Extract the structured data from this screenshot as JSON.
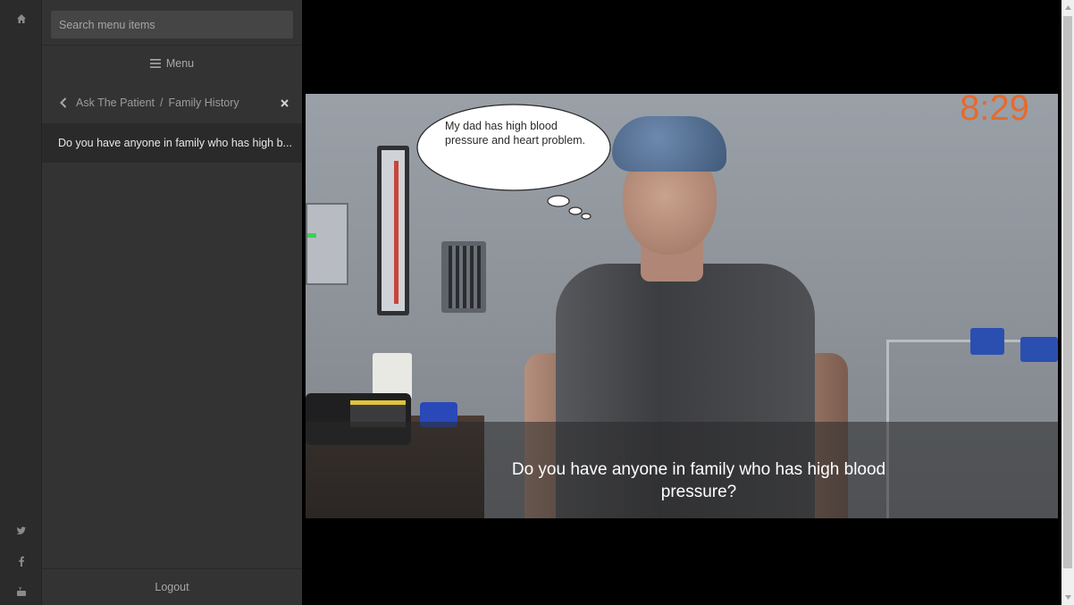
{
  "rail": {
    "home_icon": "home-icon",
    "social": [
      "twitter-icon",
      "facebook-icon",
      "youtube-icon"
    ]
  },
  "menu": {
    "search_placeholder": "Search menu items",
    "toggle_label": "Menu",
    "breadcrumb": {
      "parent": "Ask The Patient",
      "separator": "/",
      "current": "Family History"
    },
    "items": [
      "Do you have anyone in family who has high b..."
    ],
    "logout_label": "Logout"
  },
  "video": {
    "thought_bubble_text": "My dad has high blood pressure and heart problem.",
    "timer": "8:29",
    "subtitle_line1": "Do you have anyone in family who has high blood",
    "subtitle_line2": "pressure?"
  },
  "colors": {
    "timer": "#e66a2e",
    "panel_bg": "#333333",
    "rail_bg": "#2b2b2b",
    "selected_item_bg": "#2a2a2a"
  }
}
